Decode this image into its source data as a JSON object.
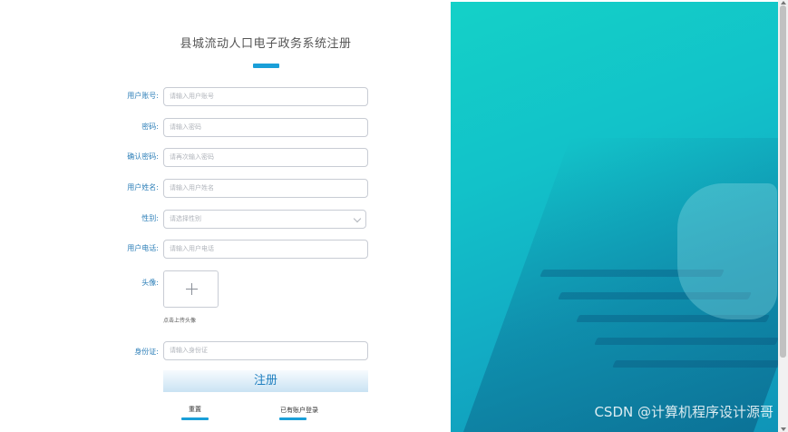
{
  "form": {
    "title": "县城流动人口电子政务系统注册",
    "fields": [
      {
        "label": "用户账号:",
        "placeholder": "请输入用户账号"
      },
      {
        "label": "密码:",
        "placeholder": "请输入密码"
      },
      {
        "label": "确认密码:",
        "placeholder": "请再次输入密码"
      },
      {
        "label": "用户姓名:",
        "placeholder": "请输入用户姓名"
      },
      {
        "label": "性别:",
        "placeholder": "请选择性别"
      },
      {
        "label": "用户电话:",
        "placeholder": "请输入用户电话"
      }
    ],
    "avatar_label": "头像:",
    "avatar_hint": "点击上传头像",
    "id_label": "身份证:",
    "id_placeholder": "请输入身份证",
    "register_label": "注册",
    "reset_label": "重置",
    "login_link": "已有账户登录"
  },
  "colors": {
    "accent": "#1a9fd8",
    "label": "#2d7fb8",
    "panel_start": "#14d1c8",
    "panel_end": "#0f94b7"
  },
  "watermark": "CSDN @计算机程序设计源哥"
}
